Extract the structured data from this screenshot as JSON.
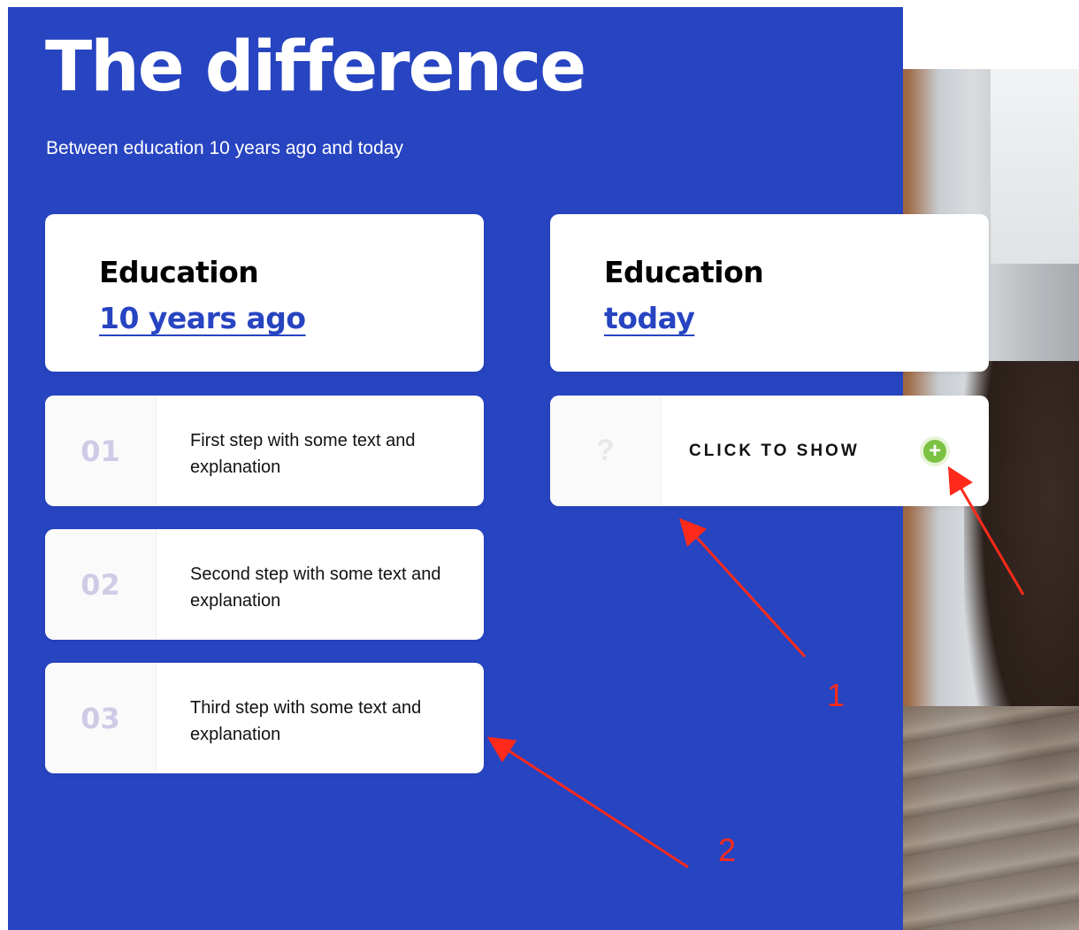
{
  "page": {
    "title": "The difference",
    "subtitle": "Between education 10 years ago and today"
  },
  "comparison": {
    "left": {
      "line1": "Education",
      "line2": "10 years ago"
    },
    "right": {
      "line1": "Education",
      "line2": "today"
    }
  },
  "steps": [
    {
      "number": "01",
      "text": "First step with some text and explanation"
    },
    {
      "number": "02",
      "text": "Second step with some text and explanation"
    },
    {
      "number": "03",
      "text": "Third step with some text and explanation"
    }
  ],
  "reveal": {
    "placeholder": "?",
    "label": "CLICK TO SHOW",
    "button_glyph": "+"
  },
  "annotations": {
    "label_1": "1",
    "label_2": "2"
  },
  "colors": {
    "panel_blue": "#2744c1",
    "step_number": "#cfcbe6",
    "plus_green": "#7cc242",
    "annotation_red": "#ff2a1a"
  },
  "icons": [
    "plus-icon",
    "question-mark-icon"
  ]
}
